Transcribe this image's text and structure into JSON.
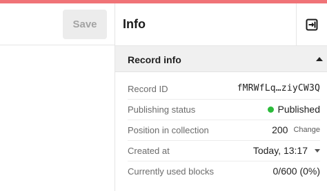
{
  "toolbar": {
    "save_label": "Save"
  },
  "panel": {
    "title": "Info",
    "exit_icon": "sidebar-exit-icon",
    "section": {
      "title": "Record info",
      "expanded": true,
      "rows": [
        {
          "label": "Record ID",
          "value": "fMRWfLq…ziyCW3Q"
        },
        {
          "label": "Publishing status",
          "value": "Published",
          "status_color": "#2bbb3a"
        },
        {
          "label": "Position in collection",
          "value": "200",
          "action": "Change"
        },
        {
          "label": "Created at",
          "value": "Today, 13:17"
        },
        {
          "label": "Currently used blocks",
          "value": "0/600 (0%)"
        }
      ]
    }
  },
  "colors": {
    "accent": "#f07377",
    "status_published": "#2bbb3a"
  }
}
